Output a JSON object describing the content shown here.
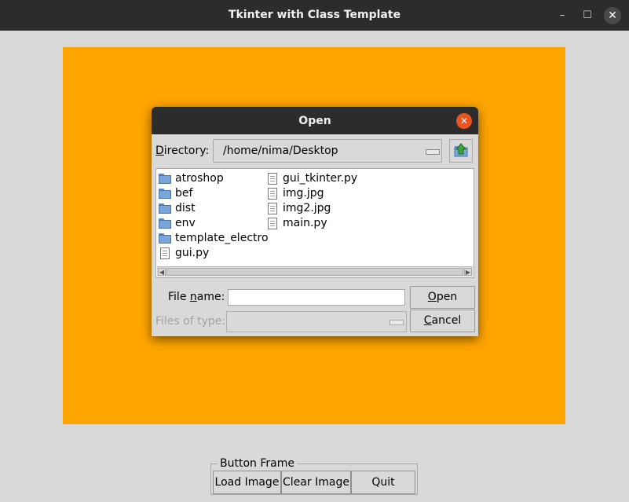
{
  "window": {
    "title": "Tkinter with Class Template",
    "controls": {
      "minimize": "–",
      "maximize": "☐",
      "close": "✕"
    }
  },
  "canvas": {
    "color": "#ffa500"
  },
  "dialog": {
    "title": "Open",
    "close_glyph": "✕",
    "directory_label": "irectory:",
    "directory_label_underlined": "D",
    "directory_value": "/home/nima/Desktop",
    "files_left": [
      {
        "name": "atroshop",
        "icon": "folder-icon"
      },
      {
        "name": "bef",
        "icon": "folder-icon"
      },
      {
        "name": "dist",
        "icon": "folder-icon"
      },
      {
        "name": "env",
        "icon": "folder-icon"
      },
      {
        "name": "template_electro",
        "icon": "folder-icon"
      },
      {
        "name": "gui.py",
        "icon": "file-icon"
      }
    ],
    "files_right": [
      {
        "name": "gui_tkinter.py",
        "icon": "file-icon"
      },
      {
        "name": "img.jpg",
        "icon": "file-icon"
      },
      {
        "name": "img2.jpg",
        "icon": "file-icon"
      },
      {
        "name": "main.py",
        "icon": "file-icon"
      }
    ],
    "filename_label_pre": "File ",
    "filename_label_u": "n",
    "filename_label_post": "ame:",
    "filename_value": "",
    "filetype_label": "Files of type:",
    "filetype_value": "",
    "open_label_u": "O",
    "open_label_rest": "pen",
    "cancel_label_u": "C",
    "cancel_label_rest": "ancel"
  },
  "button_frame": {
    "legend": "Button Frame",
    "load": "Load Image",
    "clear": "Clear Image",
    "quit": "Quit"
  }
}
